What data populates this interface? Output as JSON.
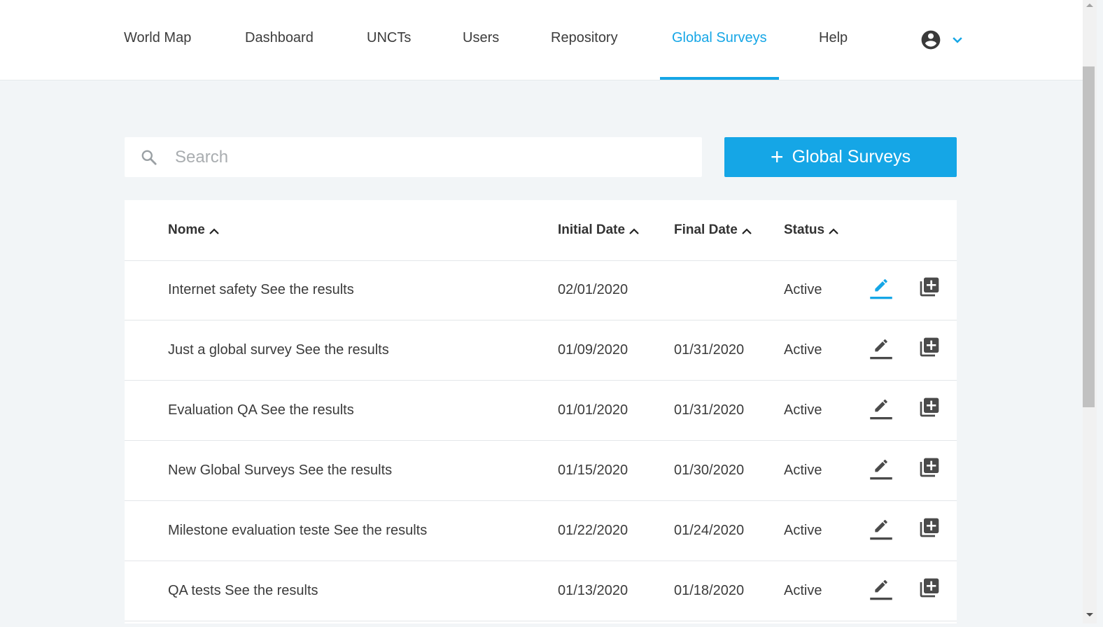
{
  "nav": {
    "items": [
      {
        "label": "World Map",
        "active": false
      },
      {
        "label": "Dashboard",
        "active": false
      },
      {
        "label": "UNCTs",
        "active": false
      },
      {
        "label": "Users",
        "active": false
      },
      {
        "label": "Repository",
        "active": false
      },
      {
        "label": "Global Surveys",
        "active": true
      },
      {
        "label": "Help",
        "active": false
      }
    ],
    "user_icon": "account-circle-icon",
    "user_menu_icon": "chevron-down-icon"
  },
  "search": {
    "placeholder": "Search",
    "value": "",
    "icon": "search-icon"
  },
  "add_button": {
    "icon": "+",
    "label": "Global Surveys"
  },
  "table": {
    "columns": [
      {
        "label": "Nome",
        "sort": "asc"
      },
      {
        "label": "Initial Date",
        "sort": "asc"
      },
      {
        "label": "Final Date",
        "sort": "asc"
      },
      {
        "label": "Status",
        "sort": "asc"
      }
    ],
    "rows": [
      {
        "name": "Internet safety See the results",
        "initial_date": "02/01/2020",
        "final_date": "",
        "status": "Active",
        "edit_highlighted": true
      },
      {
        "name": "Just a global survey See the results",
        "initial_date": "01/09/2020",
        "final_date": "01/31/2020",
        "status": "Active",
        "edit_highlighted": false
      },
      {
        "name": "Evaluation QA See the results",
        "initial_date": "01/01/2020",
        "final_date": "01/31/2020",
        "status": "Active",
        "edit_highlighted": false
      },
      {
        "name": "New Global Surveys See the results",
        "initial_date": "01/15/2020",
        "final_date": "01/30/2020",
        "status": "Active",
        "edit_highlighted": false
      },
      {
        "name": "Milestone evaluation teste See the results",
        "initial_date": "01/22/2020",
        "final_date": "01/24/2020",
        "status": "Active",
        "edit_highlighted": false
      },
      {
        "name": "QA tests See the results",
        "initial_date": "01/13/2020",
        "final_date": "01/18/2020",
        "status": "Active",
        "edit_highlighted": false
      }
    ],
    "row_icons": {
      "edit": "pencil-edit-icon",
      "add": "library-add-icon"
    }
  },
  "colors": {
    "accent": "#15a6e6",
    "text": "#3b3b3b",
    "background": "#f2f5f7",
    "icon": "#4a4a4a"
  }
}
